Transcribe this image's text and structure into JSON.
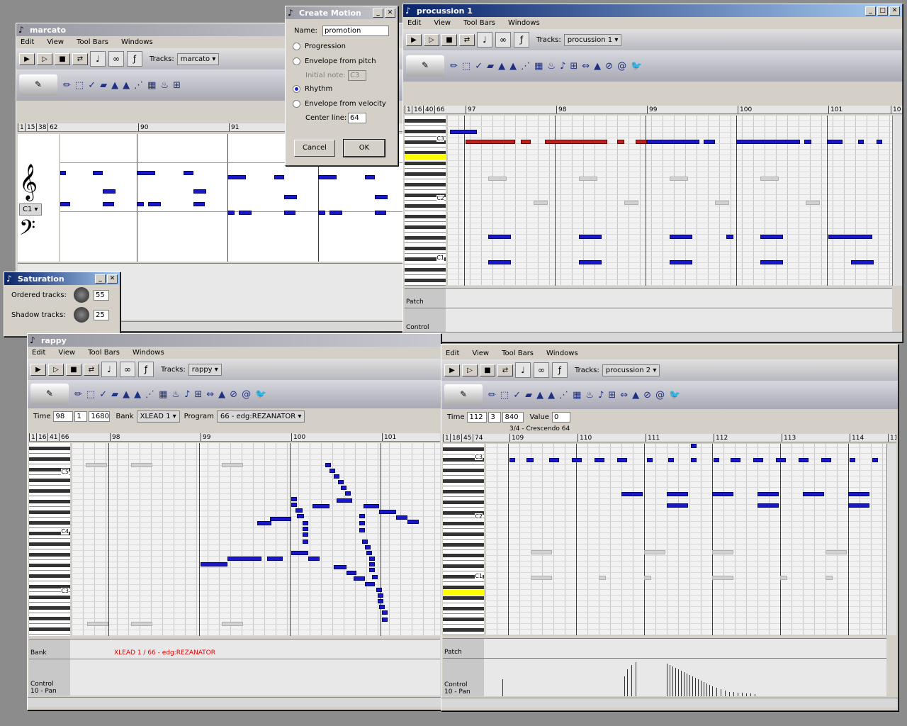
{
  "menus": [
    "Edit",
    "View",
    "Tool Bars",
    "Windows"
  ],
  "tracks_label": "Tracks:",
  "marcato": {
    "title": "marcato",
    "track": "marcato",
    "ruler": [
      "1",
      "15",
      "38",
      "62",
      "90",
      "91"
    ],
    "clef_drop": "C1"
  },
  "procussion1": {
    "title": "procussion 1",
    "track": "procussion 1",
    "ruler": [
      "1",
      "16",
      "40",
      "66",
      "97",
      "98",
      "99",
      "100",
      "101",
      "10"
    ],
    "keys": [
      "C3",
      "C2",
      "C1"
    ],
    "lane1": "Patch",
    "lane2": "Control"
  },
  "rappy": {
    "title": "rappy",
    "track": "rappy",
    "time_label": "Time",
    "time": [
      "98",
      "1",
      "1680"
    ],
    "bank_label": "Bank",
    "bank": "XLEAD 1",
    "program_label": "Program",
    "program": "66 - edg:REZANATOR",
    "ruler": [
      "1",
      "16",
      "41",
      "66",
      "98",
      "99",
      "100",
      "101"
    ],
    "keys": [
      "C5",
      "C4",
      "C3"
    ],
    "lane1": "Bank",
    "lane1_text": "XLEAD 1 / 66 - edg:REZANATOR",
    "lane2": "Control",
    "lane2_sub": "10 - Pan"
  },
  "procussion2": {
    "track": "procussion 2",
    "time_label": "Time",
    "time": [
      "112",
      "3",
      "840"
    ],
    "value_label": "Value",
    "value": "0",
    "marker": "3/4 - Crescendo 64",
    "ruler": [
      "1",
      "18",
      "45",
      "74",
      "109",
      "110",
      "111",
      "112",
      "113",
      "114",
      "11"
    ],
    "keys": [
      "C3",
      "C2",
      "C1"
    ],
    "lane1": "Patch",
    "lane2": "Control",
    "lane2_sub": "10 - Pan"
  },
  "create_motion": {
    "title": "Create Motion",
    "name_label": "Name:",
    "name_value": "promotion",
    "options": [
      "Progression",
      "Envelope from pitch",
      "Rhythm",
      "Envelope from velocity"
    ],
    "selected": 2,
    "initial_note_label": "Initial note:",
    "initial_note": "C3",
    "center_line_label": "Center line:",
    "center_line": "64",
    "cancel": "Cancel",
    "ok": "OK"
  },
  "saturation": {
    "title": "Saturation",
    "ordered_label": "Ordered tracks:",
    "ordered_value": "55",
    "shadow_label": "Shadow tracks:",
    "shadow_value": "25"
  },
  "colors": {
    "note": "#1818c8",
    "titlebar": "#0a246a"
  }
}
